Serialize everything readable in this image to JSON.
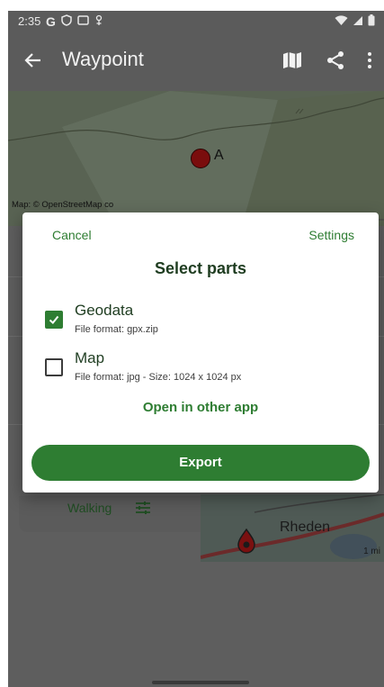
{
  "status_bar": {
    "time": "2:35",
    "icons": [
      "google-g-icon",
      "shield-icon",
      "screen-icon",
      "location-dot-icon",
      "wifi-icon",
      "signal-icon",
      "battery-icon"
    ]
  },
  "app_bar": {
    "title": "Waypoint",
    "actions": [
      "map-icon",
      "share-icon",
      "overflow-menu-icon"
    ]
  },
  "map": {
    "attribution": "Map: © OpenStreetMap co",
    "marker_label": "A"
  },
  "background_page": {
    "route_mode": "Walking",
    "map_place": "Rheden",
    "scale_label": "1 mi"
  },
  "dialog": {
    "cancel_label": "Cancel",
    "settings_label": "Settings",
    "heading": "Select parts",
    "options": [
      {
        "label": "Geodata",
        "detail": "File format: gpx.zip",
        "checked": true
      },
      {
        "label": "Map",
        "detail": "File format: jpg - Size: 1024 x 1024 px",
        "checked": false
      }
    ],
    "open_other_label": "Open in other app",
    "export_label": "Export"
  },
  "colors": {
    "accent": "#2e7d32",
    "scrim": "#5e5e5e",
    "heading_text": "#1f3d21"
  }
}
